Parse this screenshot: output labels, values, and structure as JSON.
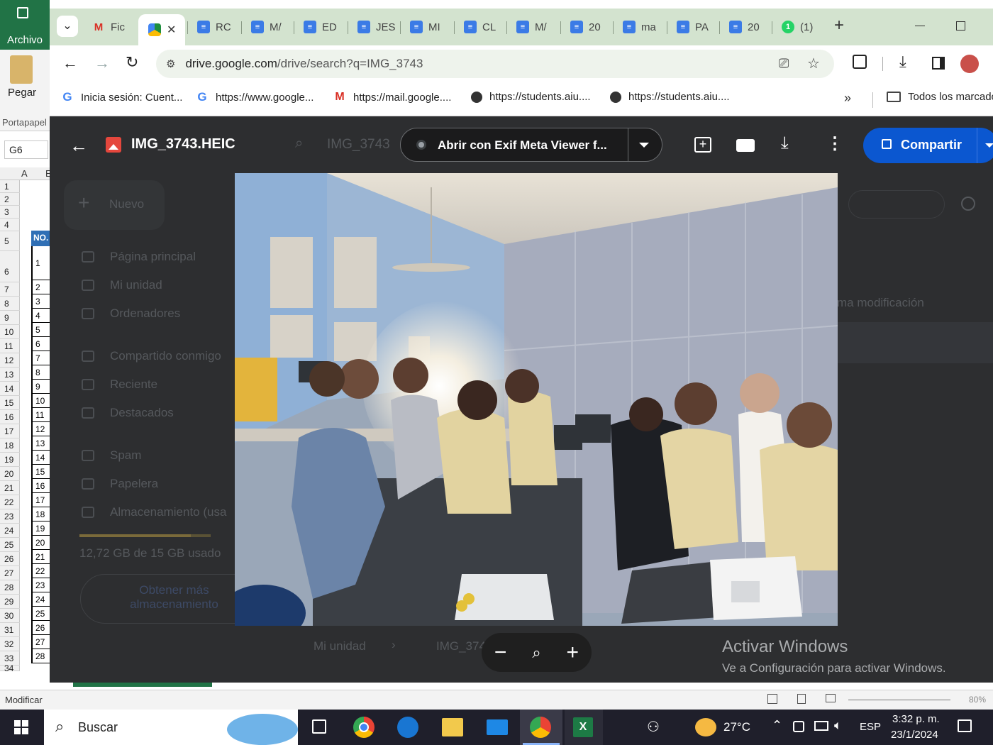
{
  "excel": {
    "menu_archivo": "Archivo",
    "pegar": "Pegar",
    "portapapeles": "Portapapel",
    "name_box": "G6",
    "col_a": "A",
    "col_b": "E",
    "header_cell": "NO.",
    "row_numbers": [
      "1",
      "2",
      "3",
      "4",
      "5",
      "6",
      "7",
      "8",
      "9",
      "10",
      "11",
      "12",
      "13",
      "14",
      "15",
      "16",
      "17",
      "18",
      "19",
      "20",
      "21",
      "22",
      "23",
      "24",
      "25",
      "26",
      "27",
      "28",
      "29",
      "30",
      "31",
      "32",
      "33",
      "34"
    ],
    "no_values": [
      "1",
      "2",
      "3",
      "4",
      "5",
      "6",
      "7",
      "8",
      "9",
      "10",
      "11",
      "12",
      "13",
      "14",
      "15",
      "16",
      "17",
      "18",
      "19",
      "20",
      "21",
      "22",
      "23",
      "24",
      "25",
      "26",
      "27",
      "28"
    ],
    "status_text": "Modificar",
    "zoom_level": "80%"
  },
  "chrome": {
    "tabs": [
      {
        "label": "Fic",
        "icon": "gmail-icon"
      },
      {
        "label": "",
        "icon": "drive-icon",
        "active": true
      },
      {
        "label": "RC",
        "icon": "docs-icon"
      },
      {
        "label": "M/",
        "icon": "docs-icon"
      },
      {
        "label": "ED",
        "icon": "docs-icon"
      },
      {
        "label": "JES",
        "icon": "docs-icon"
      },
      {
        "label": "MI",
        "icon": "docs-icon"
      },
      {
        "label": "CL",
        "icon": "docs-icon"
      },
      {
        "label": "M/",
        "icon": "docs-icon"
      },
      {
        "label": "20",
        "icon": "docs-icon"
      },
      {
        "label": "ma",
        "icon": "docs-icon"
      },
      {
        "label": "PA",
        "icon": "docs-icon"
      },
      {
        "label": "20",
        "icon": "docs-icon"
      },
      {
        "label": "(1)",
        "icon": "whatsapp-icon"
      }
    ],
    "url_host": "drive.google.com",
    "url_path": "/drive/search?q=IMG_3743",
    "bookmarks": [
      {
        "label": "Inicia sesión: Cuent...",
        "icon": "google-icon"
      },
      {
        "label": "https://www.google...",
        "icon": "google-icon"
      },
      {
        "label": "https://mail.google....",
        "icon": "gmail-icon"
      },
      {
        "label": "https://students.aiu....",
        "icon": "globe-icon"
      },
      {
        "label": "https://students.aiu....",
        "icon": "globe-icon"
      }
    ],
    "all_bookmarks": "Todos los marcado"
  },
  "drive": {
    "file_name": "IMG_3743.HEIC",
    "search_text": "IMG_3743",
    "open_with": "Abrir con Exif Meta Viewer f...",
    "share_label": "Compartir",
    "new_label": "Nuevo",
    "nav": [
      "Página principal",
      "Mi unidad",
      "Ordenadores",
      "Compartido conmigo",
      "Reciente",
      "Destacados",
      "Spam",
      "Papelera",
      "Almacenamiento (usa"
    ],
    "storage_text": "12,72 GB de 15 GB usado",
    "storage_fraction": 0.848,
    "get_more_line1": "Obtener más",
    "get_more_line2": "almacenamiento",
    "last_modified_col": "ma modificación",
    "breadcrumb_root": "Mi unidad",
    "breadcrumb_file": "IMG_374",
    "activate_title": "Activar Windows",
    "activate_sub": "Ve a Configuración para activar Windows."
  },
  "taskbar": {
    "search_placeholder": "Buscar",
    "weather": "27°C",
    "language": "ESP",
    "time": "3:32 p. m.",
    "date": "23/1/2024"
  }
}
